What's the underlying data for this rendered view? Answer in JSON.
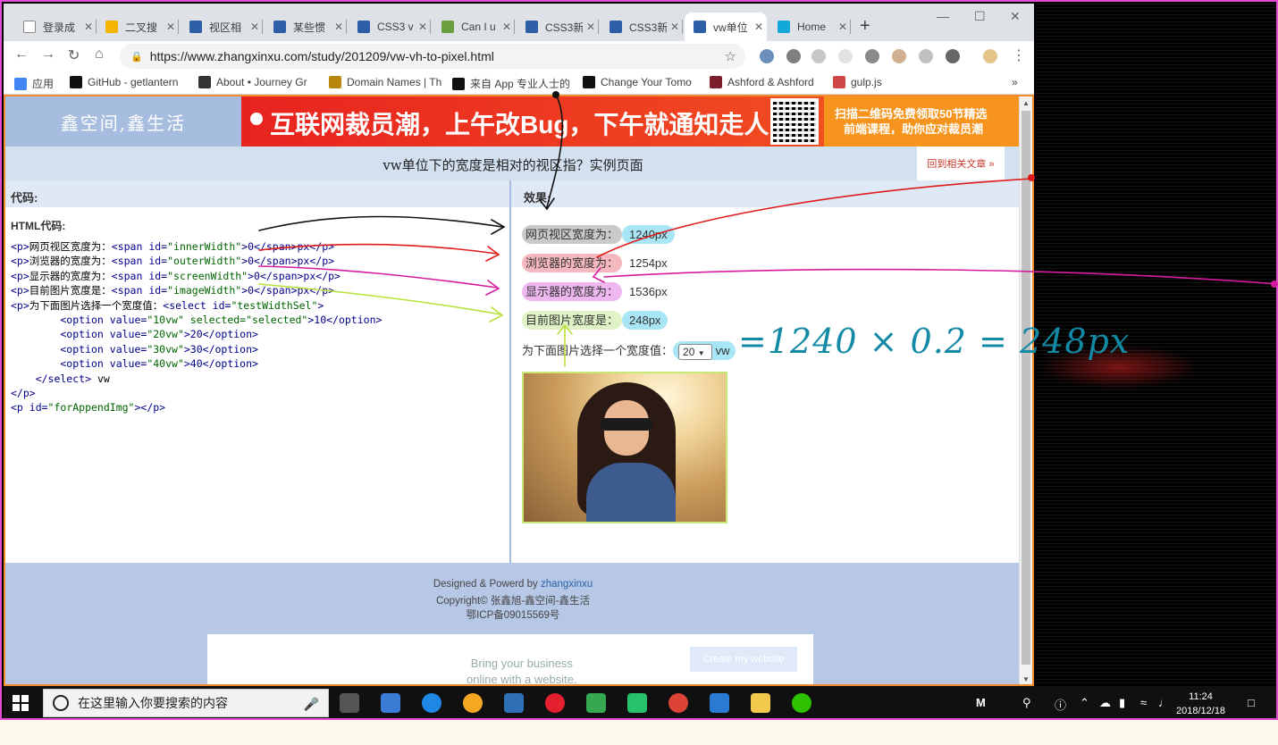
{
  "browser": {
    "tabs": [
      {
        "label": "登录成",
        "color": "#ffffff"
      },
      {
        "label": "二叉搜",
        "color": "#f5b400"
      },
      {
        "label": "视区相",
        "color": "#2d5fa7"
      },
      {
        "label": "某些惯",
        "color": "#2d5fa7"
      },
      {
        "label": "CSS3 v",
        "color": "#2d5fa7"
      },
      {
        "label": "Can I u",
        "color": "#6a9e3f"
      },
      {
        "label": "CSS3新",
        "color": "#2d5fa7"
      },
      {
        "label": "CSS3新",
        "color": "#2d5fa7"
      },
      {
        "label": "vw单位",
        "color": "#2d5fa7"
      },
      {
        "label": "Home",
        "color": "#12a8d8"
      }
    ],
    "url": "https://www.zhangxinxu.com/study/201209/vw-vh-to-pixel.html",
    "bookmarks": [
      {
        "label": "应用",
        "color": "#4285f4"
      },
      {
        "label": "GitHub - getlantern",
        "color": "#111111"
      },
      {
        "label": "About • Journey Gr",
        "color": "#333333"
      },
      {
        "label": "Domain Names | Th",
        "color": "#b8860b"
      },
      {
        "label": "来自 App 专业人士的",
        "color": "#111111"
      },
      {
        "label": "Change Your Tomo",
        "color": "#111111"
      },
      {
        "label": "Ashford & Ashford",
        "color": "#7a1f2b"
      },
      {
        "label": "gulp.js",
        "color": "#cf4647"
      }
    ],
    "more_bookmarks": "»"
  },
  "page": {
    "logo": "鑫空间,鑫生活",
    "banner_text": "互联网裁员潮，上午改Bug，下午就通知走人!",
    "banner_side_line1": "扫描二维码免费领取50节精选",
    "banner_side_line2": "前端课程，助你应对裁员潮",
    "title": "vw单位下的宽度是相对的视区指？实例页面",
    "back_link": "回到相关文章 »",
    "code_header": "代码:",
    "html_code_title": "HTML代码:",
    "code_lines": [
      {
        "pre": "<p>",
        "text": "网页视区宽度为：",
        "tag": "<span id=",
        "str": "\"innerWidth\"",
        "rest": ">0</span>px</p>"
      },
      {
        "pre": "<p>",
        "text": "浏览器的宽度为：",
        "tag": "<span id=",
        "str": "\"outerWidth\"",
        "rest": ">0</span>px</p>"
      },
      {
        "pre": "<p>",
        "text": "显示器的宽度为：",
        "tag": "<span id=",
        "str": "\"screenWidth\"",
        "rest": ">0</span>px</p>"
      },
      {
        "pre": "<p>",
        "text": "目前图片宽度是：",
        "tag": "<span id=",
        "str": "\"imageWidth\"",
        "rest": ">0</span>px</p>"
      },
      {
        "pre": "<p>",
        "text": "为下面图片选择一个宽度值：",
        "tag": "<select id=",
        "str": "\"testWidthSel\"",
        "rest": ">"
      },
      {
        "pre": "        <option value=",
        "text": "",
        "tag": "",
        "str": "\"10vw\" selected=\"selected\"",
        "rest": ">10</option>"
      },
      {
        "pre": "        <option value=",
        "text": "",
        "tag": "",
        "str": "\"20vw\"",
        "rest": ">20</option>"
      },
      {
        "pre": "        <option value=",
        "text": "",
        "tag": "",
        "str": "\"30vw\"",
        "rest": ">30</option>"
      },
      {
        "pre": "        <option value=",
        "text": "",
        "tag": "",
        "str": "\"40vw\"",
        "rest": ">40</option>"
      },
      {
        "pre": "    </select>",
        "text": " vw",
        "tag": "",
        "str": "",
        "rest": ""
      },
      {
        "pre": "</p>",
        "text": "",
        "tag": "",
        "str": "",
        "rest": ""
      },
      {
        "pre": "<p id=",
        "text": "",
        "tag": "",
        "str": "\"forAppendImg\"",
        "rest": "></p>"
      }
    ],
    "effect_header": "效果:",
    "effect": {
      "viewport_label": "网页视区宽度为：",
      "viewport_value": "1240px",
      "browser_label": "浏览器的宽度为：",
      "browser_value": "1254px",
      "screen_label": "显示器的宽度为：",
      "screen_value": "1536px",
      "image_label": "目前图片宽度是：",
      "image_value": "248px",
      "select_label": "为下面图片选择一个宽度值：",
      "select_value": "20",
      "select_unit": "vw"
    },
    "footer": {
      "designed_prefix": "Designed & Powerd by ",
      "designed_author": "zhangxinxu",
      "copyright": "Copyright© 张鑫旭-鑫空间-鑫生活",
      "icp": "鄂ICP备09015569号",
      "ad_text_line1": "Bring your business",
      "ad_text_line2": "online with a website.",
      "ad_button": "Create my website"
    }
  },
  "annotation": {
    "handwritten": "=1240 × 0.2 = 248px"
  },
  "taskbar": {
    "search_placeholder": "在这里输入你要搜索的内容",
    "time": "11:24",
    "date": "2018/12/18",
    "tray_label": "M"
  }
}
